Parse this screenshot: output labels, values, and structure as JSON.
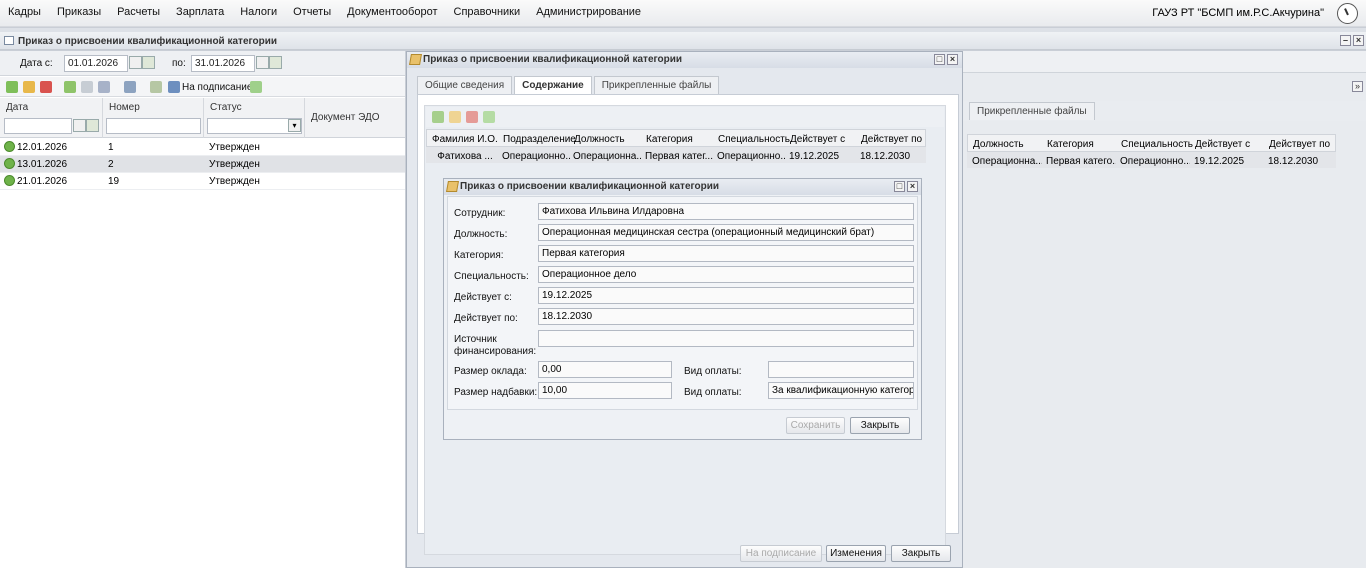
{
  "menu": [
    "Кадры",
    "Приказы",
    "Расчеты",
    "Зарплата",
    "Налоги",
    "Отчеты",
    "Документооборот",
    "Справочники",
    "Администрирование"
  ],
  "org": "ГАУЗ РТ \"БСМП им.Р.С.Акчурина\"",
  "panel_title": "Приказ о присвоении квалификационной категории",
  "filter": {
    "date_from_label": "Дата с:",
    "date_from": "01.01.2026",
    "date_to_label": "по:",
    "date_to": "31.01.2026"
  },
  "toolbar": {
    "sign_label": "На подписание"
  },
  "list": {
    "columns": [
      "Дата",
      "Номер",
      "Статус",
      "Документ ЭДО"
    ],
    "rows": [
      {
        "date": "12.01.2026",
        "num": "1",
        "status": "Утвержден"
      },
      {
        "date": "13.01.2026",
        "num": "2",
        "status": "Утвержден"
      },
      {
        "date": "21.01.2026",
        "num": "19",
        "status": "Утвержден"
      }
    ]
  },
  "bgwin": {
    "tab": "Прикрепленные файлы",
    "columns": [
      "Должность",
      "Категория",
      "Специальность",
      "Действует с",
      "Действует по"
    ],
    "row": [
      "Операционна...",
      "Первая катего...",
      "Операционно...",
      "19.12.2025",
      "18.12.2030"
    ]
  },
  "mid": {
    "title": "Приказ о присвоении квалификационной категории",
    "tabs": [
      "Общие сведения",
      "Содержание",
      "Прикрепленные файлы"
    ],
    "columns": [
      "Фамилия И.О.",
      "Подразделение",
      "Должность",
      "Категория",
      "Специальность",
      "Действует с",
      "Действует по"
    ],
    "row": [
      "Фатихова ...",
      "Операционно...",
      "Операционна...",
      "Первая катег...",
      "Операционно...",
      "19.12.2025",
      "18.12.2030"
    ],
    "buttons": {
      "sign": "На подписание",
      "changes": "Изменения",
      "close": "Закрыть"
    }
  },
  "dialog": {
    "title": "Приказ о присвоении квалификационной категории",
    "employee_label": "Сотрудник:",
    "employee": "Фатихова Ильвина Илдаровна",
    "position_label": "Должность:",
    "position": "Операционная медицинская сестра (операционный медицинский брат)",
    "category_label": "Категория:",
    "category": "Первая категория",
    "specialty_label": "Специальность:",
    "specialty": "Операционное дело",
    "from_label": "Действует с:",
    "from": "19.12.2025",
    "to_label": "Действует по:",
    "to": "18.12.2030",
    "source_label": "Источник финансирования:",
    "source": "",
    "salary_label": "Размер оклада:",
    "salary": "0,00",
    "pay_type_label": "Вид оплаты:",
    "pay_type1": "",
    "bonus_label": "Размер надбавки:",
    "bonus": "10,00",
    "pay_type2": "За квалификационную категори",
    "save": "Сохранить",
    "close": "Закрыть"
  },
  "colors": {
    "accent": "#6fb34a",
    "window_bg": "#e4e8ee"
  }
}
